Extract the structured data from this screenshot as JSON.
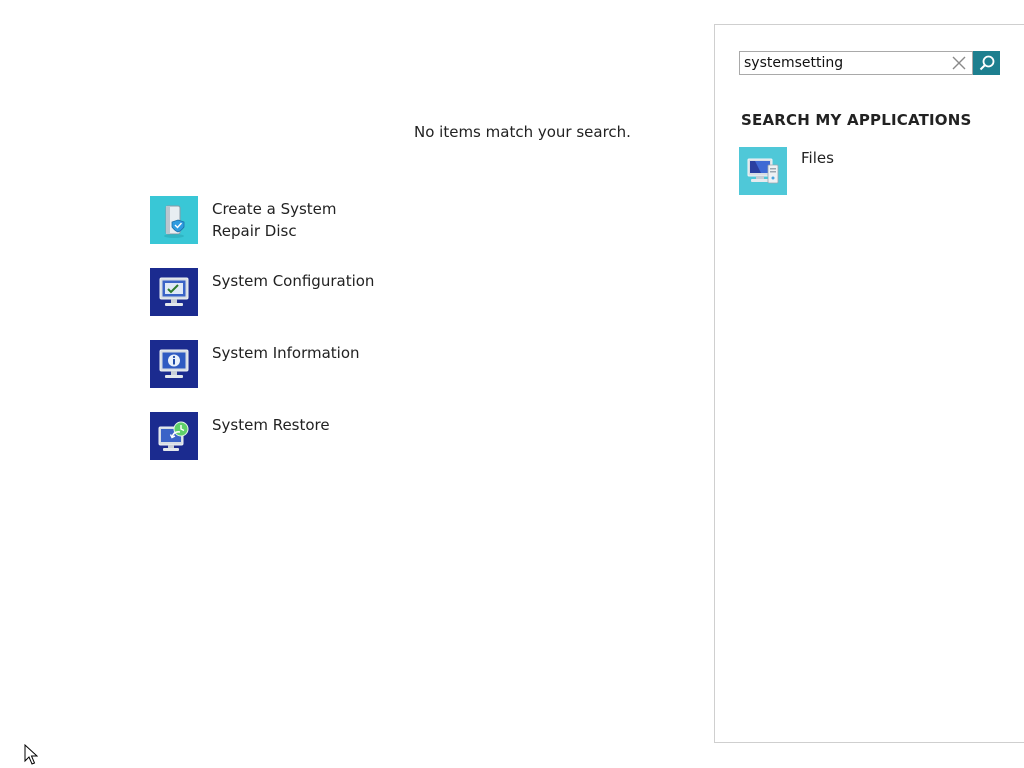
{
  "main": {
    "empty_message": "No items match your search.",
    "results": [
      {
        "label": "Create a System Repair Disc",
        "icon": "system-repair-disc-icon",
        "tile_color": "#39c7d6"
      },
      {
        "label": "System Configuration",
        "icon": "system-configuration-icon",
        "tile_color": "#1b2b8f"
      },
      {
        "label": "System Information",
        "icon": "system-information-icon",
        "tile_color": "#1b2b8f"
      },
      {
        "label": "System Restore",
        "icon": "system-restore-icon",
        "tile_color": "#1b2b8f"
      }
    ]
  },
  "search_panel": {
    "query": "systemsetting",
    "clear_icon": "close-icon",
    "search_icon": "search-icon",
    "search_button_color": "#1d7f8f",
    "heading": "SEARCH MY APPLICATIONS",
    "apps": [
      {
        "label": "Files",
        "icon": "files-icon",
        "tile_color": "#4fc8d8"
      }
    ]
  }
}
